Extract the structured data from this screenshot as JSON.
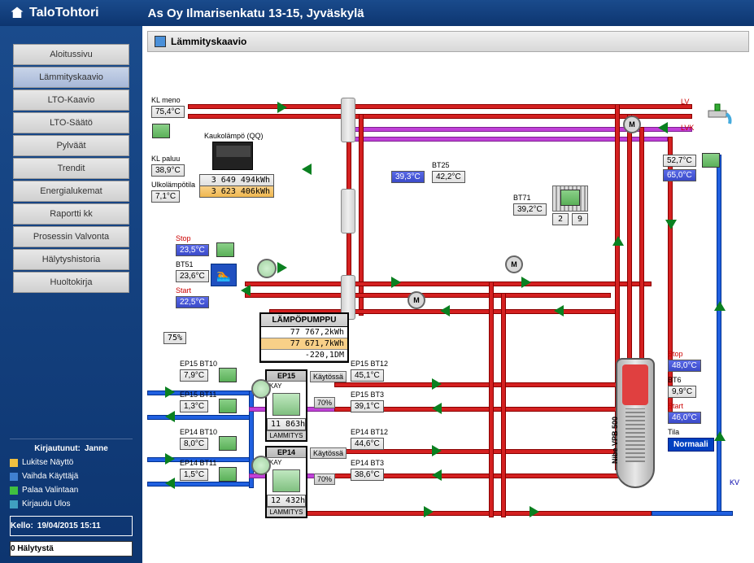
{
  "header": {
    "brand": "TaloTohtori",
    "title": "As Oy Ilmarisenkatu 13-15, Jyväskylä"
  },
  "nav": {
    "items": [
      "Aloitussivu",
      "Lämmityskaavio",
      "LTO-Kaavio",
      "LTO-Säätö",
      "Pylväät",
      "Trendit",
      "Energialukemat",
      "Raportti kk",
      "Prosessin Valvonta",
      "Hälytyshistoria",
      "Huoltokirja"
    ],
    "active": 1
  },
  "user": {
    "logged_as_label": "Kirjautunut:",
    "username": "Janne",
    "lock": "Lukitse Näyttö",
    "switch": "Vaihda Käyttäjä",
    "back": "Palaa Valintaan",
    "logout": "Kirjaudu Ulos",
    "clock_label": "Kello:",
    "clock_time": "19/04/2015 15:11",
    "alarms": "0 Hälytystä"
  },
  "panel": {
    "title": "Lämmityskaavio"
  },
  "labels": {
    "kl_meno": "KL meno",
    "kl_paluu": "KL paluu",
    "ulko": "Ulkolämpötila",
    "kaukolampo": "Kaukolämpö (QQ)",
    "stop": "Stop",
    "bt51": "BT51",
    "start": "Start",
    "lv": "LV",
    "lvk": "LVK",
    "kv": "KV",
    "bt25": "BT25",
    "bt71": "BT71",
    "ep15_bt10": "EP15 BT10",
    "ep15_bt11": "EP15 BT11",
    "ep14_bt10": "EP14 BT10",
    "ep14_bt11": "EP14 BT11",
    "ep15_bt12": "EP15 BT12",
    "ep15_bt3": "EP15 BT3",
    "ep14_bt12": "EP14 BT12",
    "ep14_bt3": "EP14 BT3",
    "bt6": "BT6",
    "tila": "Tila",
    "tank": "Nibe VPB 500",
    "lammitys": "LAMMITYS",
    "kaytossa": "Käytössä",
    "kay": "KAY"
  },
  "values": {
    "kl_meno": "75,4",
    "kl_paluu": "38,9",
    "ulko": "7,1",
    "meter_kwh1": "3 649 494kWh",
    "meter_kwh2": "3 623 406kWh",
    "stop": "23,5",
    "bt51": "23,6",
    "start": "22,5",
    "pct75": "75%",
    "bt25_l": "39,3",
    "bt25_r": "42,2",
    "bt71": "39,2",
    "rad_l": "2",
    "rad_r": "9",
    "lv_top": "52,7",
    "lv_bot": "65,0",
    "tank_stop": "48,0",
    "bt6": "9,9",
    "tank_start": "46,0",
    "status": "Normaali",
    "ep15_bt10": "7,9",
    "ep15_bt11": "1,3",
    "ep14_bt10": "8,0",
    "ep14_bt11": "1,5",
    "ep15_bt12": "45,1",
    "ep15_bt3": "39,1",
    "ep14_bt12": "44,6",
    "ep14_bt3": "38,6",
    "hp_title": "LÄMPÖPUMPPU",
    "hp_kwh1": "77 767,2kWh",
    "hp_kwh2": "77 671,7kWh",
    "hp_dm": "-220,1DM",
    "ep15_h": "11 863h",
    "ep14_h": "12 432h",
    "ep15_pct": "70%",
    "ep14_pct": "70%",
    "ep15": "EP15",
    "ep14": "EP14"
  }
}
